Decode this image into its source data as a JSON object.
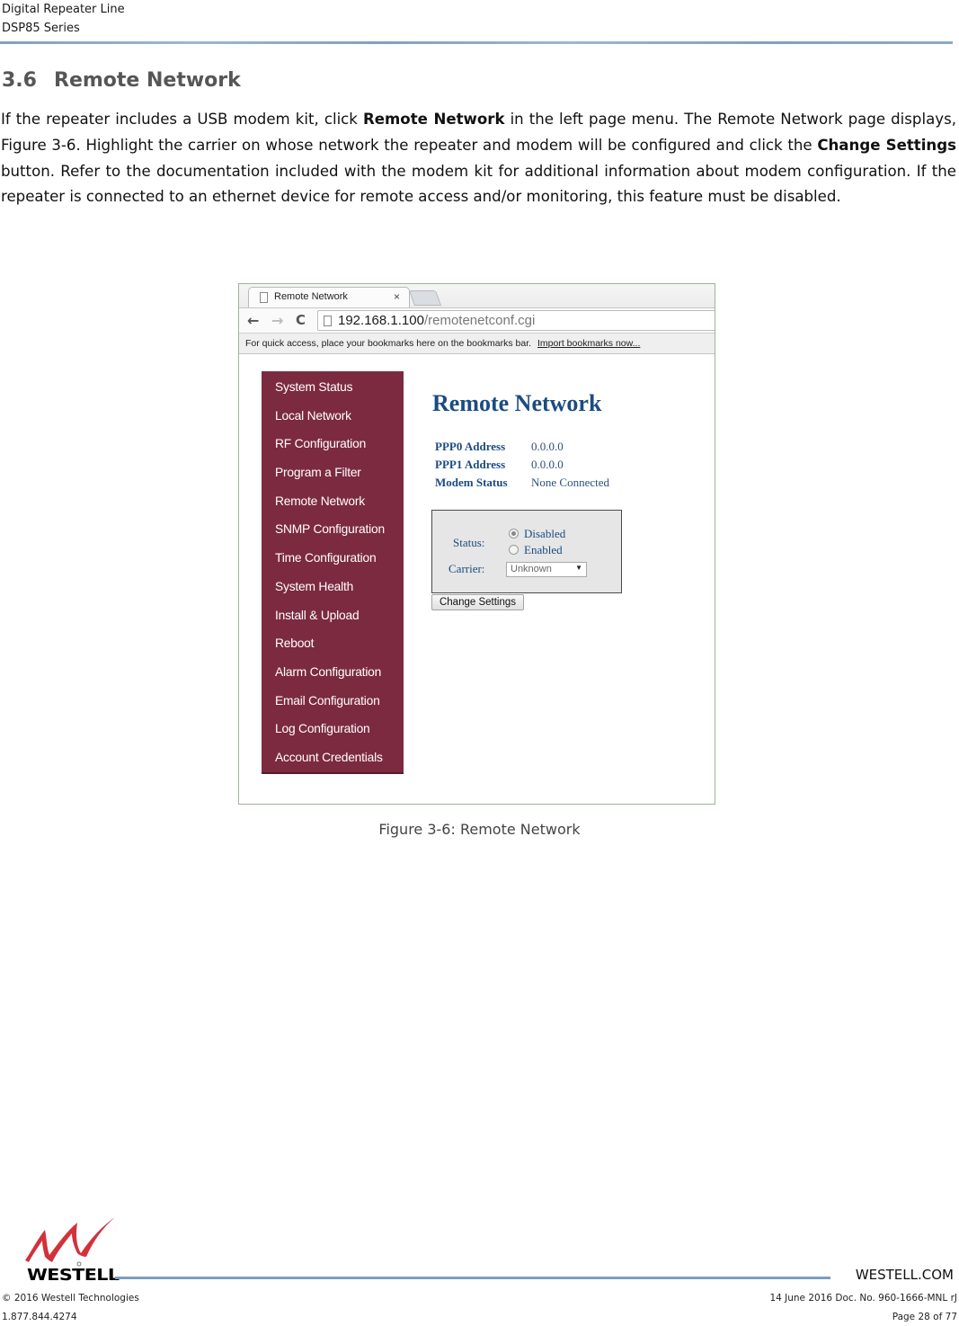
{
  "header": {
    "line1": "Digital Repeater Line",
    "line2": "DSP85 Series"
  },
  "section": {
    "number": "3.6",
    "title": "Remote Network"
  },
  "body": {
    "p1_before": "If the repeater includes a USB modem kit, click ",
    "p1_bold1": "Remote Network",
    "p1_mid": " in the left page menu. The Remote Network page displays, Figure 3-6.  Highlight the carrier on whose network the repeater and modem will be configured and click the ",
    "p1_bold2": "Change Settings",
    "p1_after": " button.  Refer to the documentation included with the modem kit for additional information about modem configuration.  If the repeater is connected to an ethernet device for remote access and/or monitoring, this feature must be disabled."
  },
  "browser": {
    "tab_title": "Remote Network",
    "tab_close": "×",
    "back_icon": "←",
    "forward_icon": "→",
    "reload_icon": "C",
    "url_host": "192.168.1.100",
    "url_path": "/remotenetconf.cgi",
    "bookmarks_text": "For quick access, place your bookmarks here on the bookmarks bar.",
    "import_link": "Import bookmarks now..."
  },
  "webpage": {
    "menu": [
      "System Status",
      "Local Network",
      "RF Configuration",
      "Program a Filter",
      "Remote Network",
      "SNMP Configuration",
      "Time Configuration",
      "System Health",
      "Install & Upload",
      "Reboot",
      "Alarm Configuration",
      "Email Configuration",
      "Log Configuration",
      "Account Credentials"
    ],
    "title": "Remote Network",
    "info": [
      {
        "label": "PPP0 Address",
        "value": "0.0.0.0"
      },
      {
        "label": "PPP1 Address",
        "value": "0.0.0.0"
      },
      {
        "label": "Modem Status",
        "value": "None Connected"
      }
    ],
    "status_label": "Status:",
    "status_options": [
      {
        "label": "Disabled",
        "checked": true
      },
      {
        "label": "Enabled",
        "checked": false
      }
    ],
    "carrier_label": "Carrier:",
    "carrier_value": "Unknown",
    "carrier_arrow": "▼",
    "button_label": "Change Settings",
    "colors": {
      "menu_bg": "#7c2a3f",
      "title": "#1b4b82"
    }
  },
  "caption": "Figure 3-6: Remote Network",
  "footer": {
    "logo_text": "WESTELL",
    "website": "WESTELL.COM",
    "copyright": "© 2016 Westell Technologies",
    "doc_info": "14 June 2016 Doc. No. 960-1666-MNL rJ",
    "phone": "1.877.844.4274",
    "page": "Page 28 of 77"
  }
}
